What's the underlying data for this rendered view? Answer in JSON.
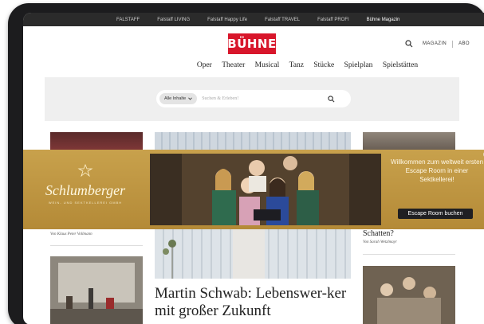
{
  "topbar": {
    "items": [
      {
        "label": "FALSTAFF"
      },
      {
        "label": "Falstaff LIVING"
      },
      {
        "label": "Falstaff Happy Life"
      },
      {
        "label": "Falstaff TRAVEL"
      },
      {
        "label": "Falstaff PROFI"
      },
      {
        "label": "Bühne Magazin"
      }
    ]
  },
  "header": {
    "logo_text": "BÜHNE",
    "magazin_label": "MAGAZIN",
    "abo_label": "ABO"
  },
  "nav": {
    "items": [
      {
        "label": "Oper"
      },
      {
        "label": "Theater"
      },
      {
        "label": "Musical"
      },
      {
        "label": "Tanz"
      },
      {
        "label": "Stücke"
      },
      {
        "label": "Spielplan"
      },
      {
        "label": "Spielstätten"
      }
    ]
  },
  "search": {
    "filter_label": "Alle Inhalte",
    "placeholder": "Suchen & Erleben!"
  },
  "articles": {
    "left_byline": "Von Klaus Peter Vollmann",
    "right_headline_fragment": "Schatten?",
    "right_byline": "Von Sarah Wetzlmayr",
    "main_headline": "Martin Schwab: Lebenswer-ker mit großer Zukunft"
  },
  "ad": {
    "brand_name": "Schlumberger",
    "brand_tagline": "WEIN- UND SEKTKELLEREI GMBH",
    "copy": "Willkommen zum weltweit ersten Escape Room in einer Sektkellerei!",
    "cta_label": "Escape Room buchen",
    "close_symbol": "×"
  },
  "colors": {
    "brand_red": "#d8162b",
    "ad_gold": "#c8a14c",
    "topbar_bg": "#2b2b2b"
  }
}
